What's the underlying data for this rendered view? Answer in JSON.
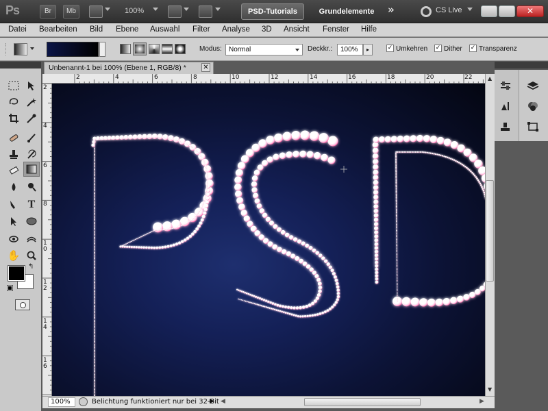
{
  "app": {
    "logo": "Ps",
    "bridge_label": "Br",
    "minibridge_label": "Mb",
    "zoom": "100%",
    "workspace_active": "PSD-Tutorials",
    "workspace_2": "Grundelemente",
    "workspace_more": "»",
    "cs_live": "CS Live",
    "close_glyph": "✕"
  },
  "menu": [
    "Datei",
    "Bearbeiten",
    "Bild",
    "Ebene",
    "Auswahl",
    "Filter",
    "Analyse",
    "3D",
    "Ansicht",
    "Fenster",
    "Hilfe"
  ],
  "options": {
    "modus_label": "Modus:",
    "modus_value": "Normal",
    "deckkraft_label": "Deckkr.:",
    "deckkraft_value": "100%",
    "umkehren": "Umkehren",
    "dither": "Dither",
    "transparenz": "Transparenz",
    "check_glyph": "✓"
  },
  "document": {
    "tab_title": "Unbenannt-1 bei 100% (Ebene 1, RGB/8) *",
    "close_glyph": "✕",
    "ruler_top": [
      "2",
      "4",
      "6",
      "8",
      "10",
      "12",
      "14",
      "16",
      "18",
      "20",
      "22"
    ],
    "ruler_left": [
      "2",
      "4",
      "6",
      "8",
      "1\n0",
      "1\n2",
      "1\n4",
      "1\n6"
    ]
  },
  "status": {
    "zoom": "100%",
    "message": "Belichtung funktioniert nur bei 32-Bit"
  },
  "colors": {
    "canvas_center": "#1e2f6f",
    "pearl_glow": "#ff2f88",
    "pearl_core": "#ffffff",
    "foreground": "#000000",
    "background": "#ffffff"
  }
}
